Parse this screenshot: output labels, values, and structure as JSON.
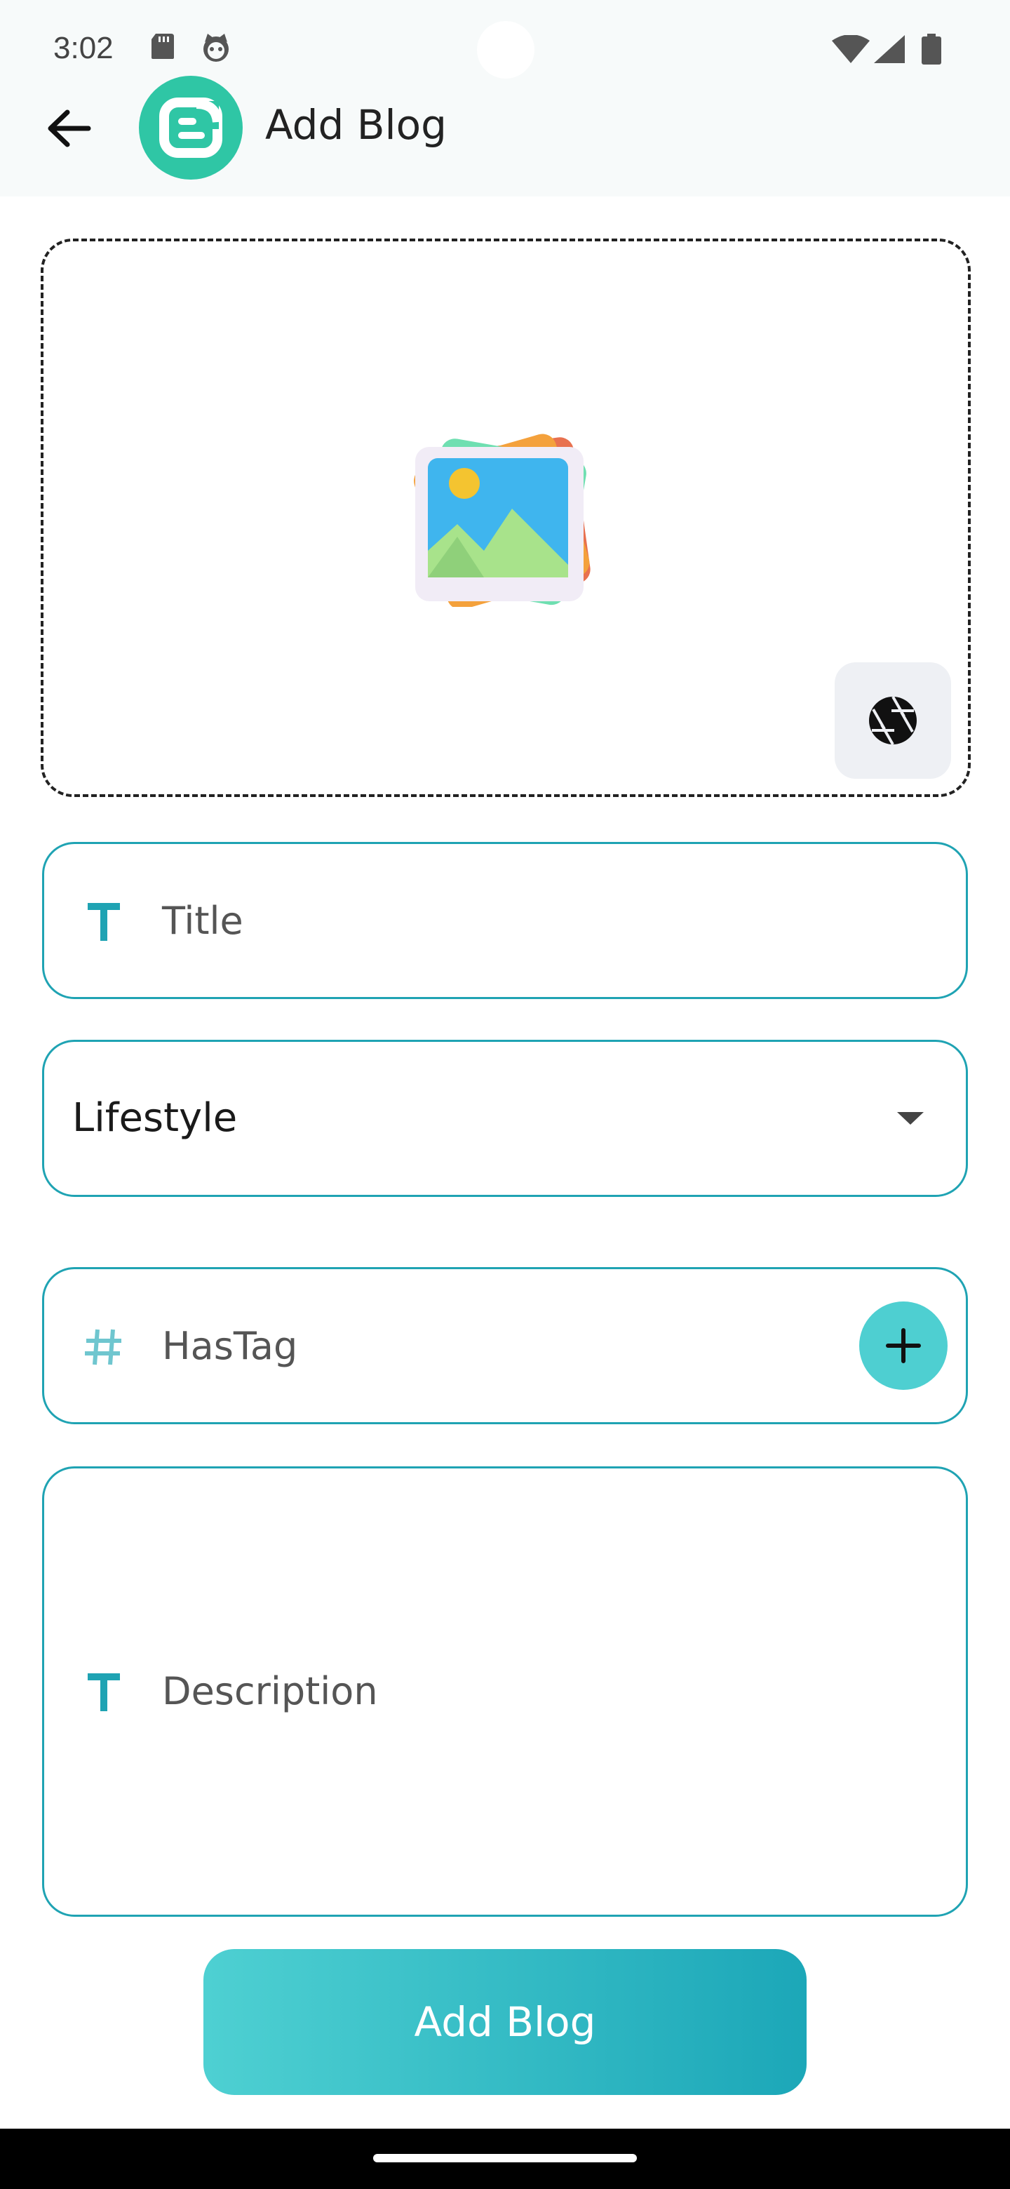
{
  "status_bar": {
    "time": "3:02",
    "icons": [
      "sd-card-icon",
      "cat-face-icon",
      "wifi-icon",
      "signal-icon",
      "battery-icon"
    ]
  },
  "app_bar": {
    "back_icon": "arrow-left-icon",
    "logo_icon": "blogger-logo-icon",
    "title": "Add Blog"
  },
  "image_picker": {
    "placeholder_icon": "image-gallery-icon",
    "camera_icon": "camera-shutter-icon"
  },
  "form": {
    "title_placeholder": "Title",
    "category_value": "Lifestyle",
    "hashtag_placeholder": "HasTag",
    "description_placeholder": "Description",
    "submit_label": "Add Blog"
  },
  "colors": {
    "accent": "#1fa3b3",
    "accent_light": "#4ecfd1",
    "logo": "#2fc6a5"
  }
}
